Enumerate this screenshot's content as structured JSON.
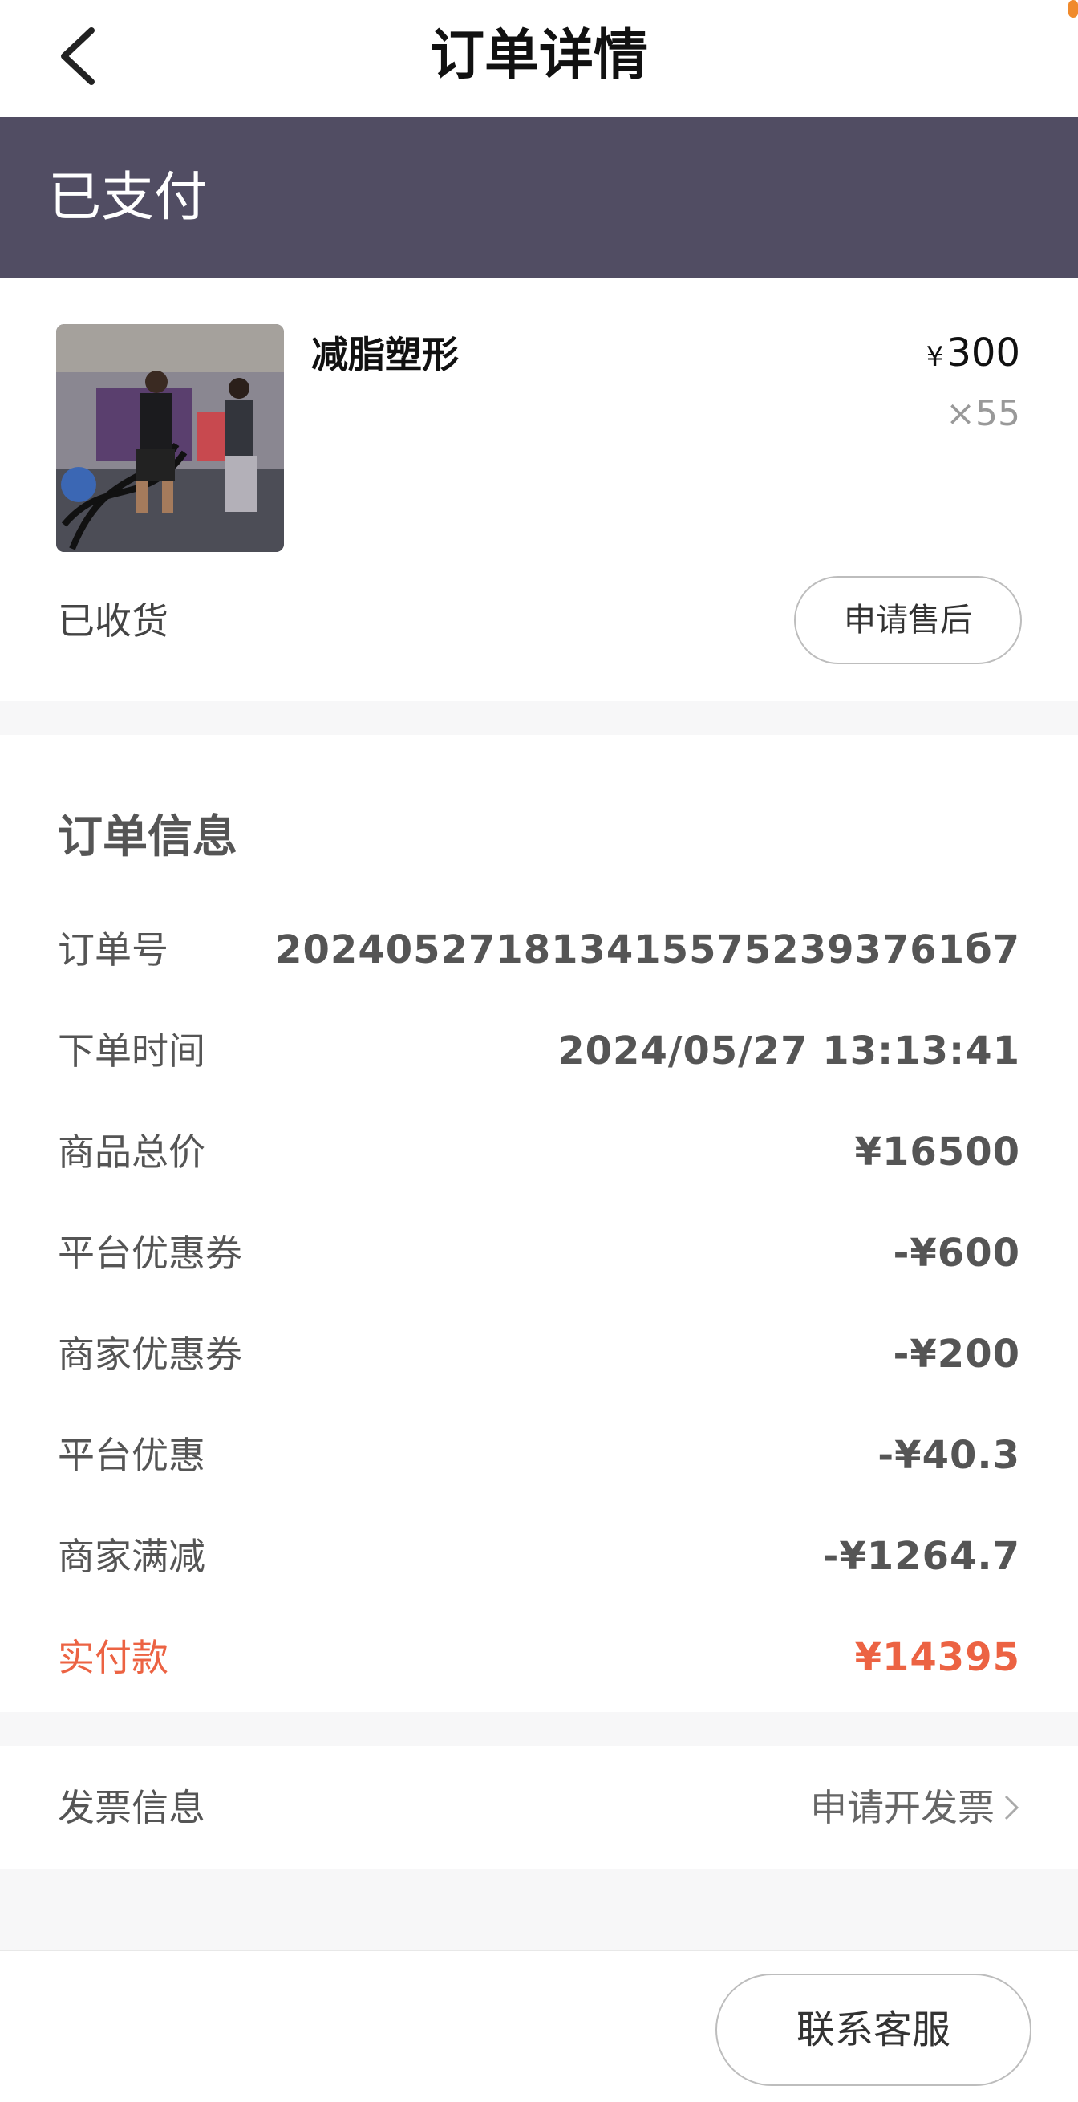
{
  "header": {
    "title": "订单详情",
    "back_icon": "chevron-left-icon"
  },
  "status": {
    "text": "已支付",
    "color": "#514d63"
  },
  "product": {
    "name": "减脂塑形",
    "price_symbol": "¥",
    "price": "300",
    "quantity": "×55",
    "receipt_status": "已收货",
    "after_sale_label": "申请售后"
  },
  "order_info": {
    "title": "订单信息",
    "rows": [
      {
        "label": "订单号",
        "value": "2024052718134155752393761б7"
      },
      {
        "label": "下单时间",
        "value": "2024/05/27 13:13:41"
      },
      {
        "label": "商品总价",
        "value": "¥16500"
      },
      {
        "label": "平台优惠券",
        "value": "-¥600"
      },
      {
        "label": "商家优惠券",
        "value": "-¥200"
      },
      {
        "label": "平台优惠",
        "value": "-¥40.3"
      },
      {
        "label": "商家满减",
        "value": "-¥1264.7"
      },
      {
        "label": "实付款",
        "value": "¥14395"
      }
    ],
    "total_color": "#ec6343"
  },
  "invoice": {
    "label": "发票信息",
    "action": "申请开发票",
    "action_icon": "chevron-right-icon"
  },
  "footer": {
    "contact_label": "联系客服"
  }
}
